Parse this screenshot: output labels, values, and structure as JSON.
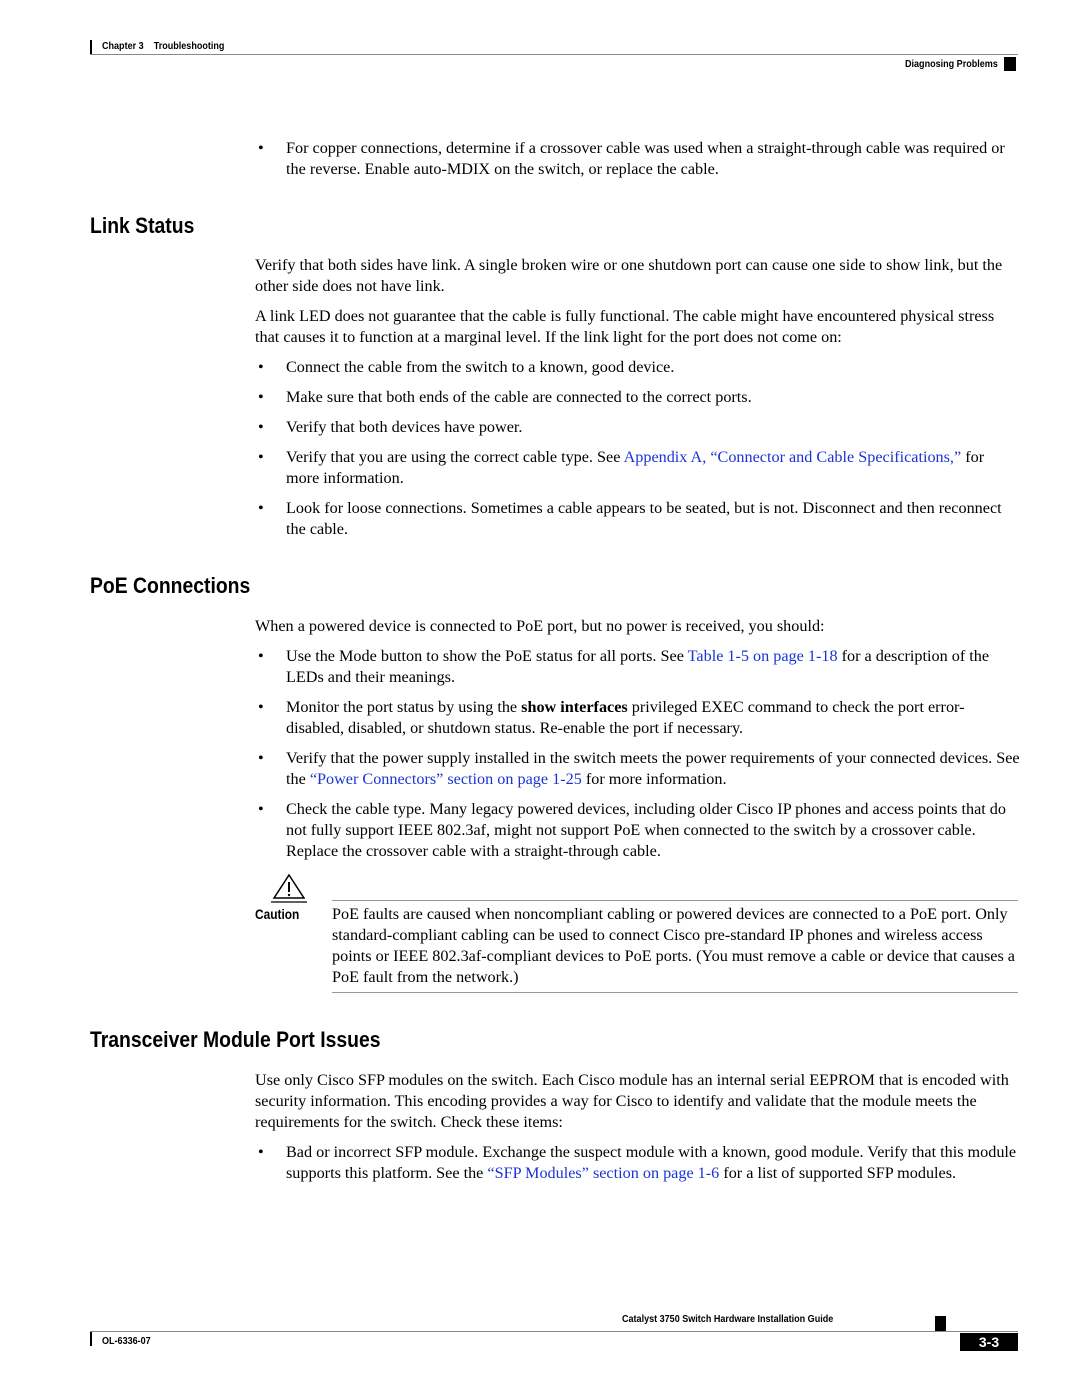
{
  "header": {
    "chapter": "Chapter 3",
    "chapter_title": "Troubleshooting",
    "section": "Diagnosing Problems"
  },
  "intro_bullets": [
    {
      "text": "For copper connections, determine if a crossover cable was used when a straight-through cable was required or the reverse. Enable auto-MDIX on the switch, or replace the cable."
    }
  ],
  "link_status": {
    "heading": "Link Status",
    "paragraphs": [
      "Verify that both sides have link. A single broken wire or one shutdown port can cause one side to show link, but the other side does not have link.",
      "A link LED does not guarantee that the cable is fully functional. The cable might have encountered physical stress that causes it to function at a marginal level. If the link light for the port does not come on:"
    ],
    "bullets": [
      {
        "text": "Connect the cable from the switch to a known, good device."
      },
      {
        "text": "Make sure that both ends of the cable are connected to the correct ports."
      },
      {
        "text": "Verify that both devices have power."
      },
      {
        "before": "Verify that you are using the correct cable type. See ",
        "link": "Appendix A, “Connector and Cable Specifications,”",
        "after": " for more information."
      },
      {
        "text": "Look for loose connections. Sometimes a cable appears to be seated, but is not. Disconnect and then reconnect the cable."
      }
    ]
  },
  "poe": {
    "heading": "PoE Connections",
    "intro": "When a powered device is connected to PoE port, but no power is received, you should:",
    "bullets": [
      {
        "before": "Use the Mode button to show the PoE status for all ports. See ",
        "link": "Table 1-5 on page 1-18",
        "after": " for a description of the LEDs and their meanings."
      },
      {
        "before": "Monitor the port status by using the ",
        "bold": "show interfaces",
        "after": " privileged EXEC command to check the port error-disabled, disabled, or shutdown status. Re-enable the port if necessary."
      },
      {
        "before": "Verify that the power supply installed in the switch meets the power requirements of your connected devices. See the ",
        "link": "“Power Connectors” section on page 1-25",
        "after": " for more information."
      },
      {
        "text": "Check the cable type. Many legacy powered devices, including older Cisco IP phones and access points that do not fully support IEEE 802.3af, might not support PoE when connected to the switch by a crossover cable. Replace the crossover cable with a straight-through cable."
      }
    ],
    "caution": {
      "label": "Caution",
      "icon": "warning-triangle-icon",
      "text": "PoE faults are caused when noncompliant cabling or powered devices are connected to a PoE port. Only standard-compliant cabling can be used to connect Cisco pre-standard IP phones and wireless access points or IEEE 802.3af-compliant devices to PoE ports. (You must remove a cable or device that causes a PoE fault from the network.)"
    }
  },
  "transceiver": {
    "heading": "Transceiver Module Port Issues",
    "intro": "Use only Cisco SFP modules on the switch. Each Cisco module has an internal serial EEPROM that is encoded with security information. This encoding provides a way for Cisco to identify and validate that the module meets the requirements for the switch. Check these items:",
    "bullets": [
      {
        "before": "Bad or incorrect SFP module. Exchange the suspect module with a known, good module. Verify that this module supports this platform. See the ",
        "link": "“SFP Modules” section on page 1-6",
        "after": " for a list of supported SFP modules."
      }
    ]
  },
  "footer": {
    "guide_title": "Catalyst 3750 Switch Hardware Installation Guide",
    "doc_number": "OL-6336-07",
    "page_number": "3-3"
  },
  "bullet_glyph": "•"
}
